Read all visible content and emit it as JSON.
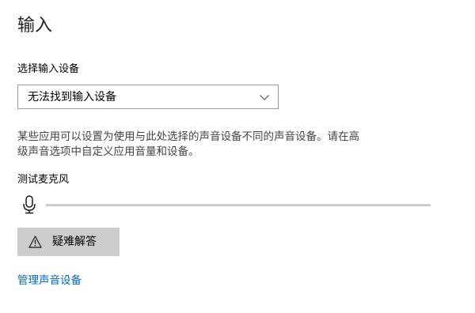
{
  "section": {
    "title": "输入"
  },
  "input_device": {
    "label": "选择输入设备",
    "selected_value": "无法找到输入设备"
  },
  "description": {
    "line1": "某些应用可以设置为使用与此处选择的声音设备不同的声音设备。请在高",
    "line2": "级声音选项中自定义应用音量和设备。"
  },
  "microphone_test": {
    "label": "测试麦克风",
    "level_fraction": 0
  },
  "troubleshoot": {
    "label": "疑难解答"
  },
  "manage_devices": {
    "label": "管理声音设备"
  },
  "icons": {
    "dropdown": "chevron-down-icon",
    "microphone": "microphone-icon",
    "troubleshoot": "warning-icon"
  },
  "colors": {
    "accent": "#0078d7",
    "link": "#0067c0",
    "button_bg": "#cccccc",
    "track": "#cccccc"
  }
}
